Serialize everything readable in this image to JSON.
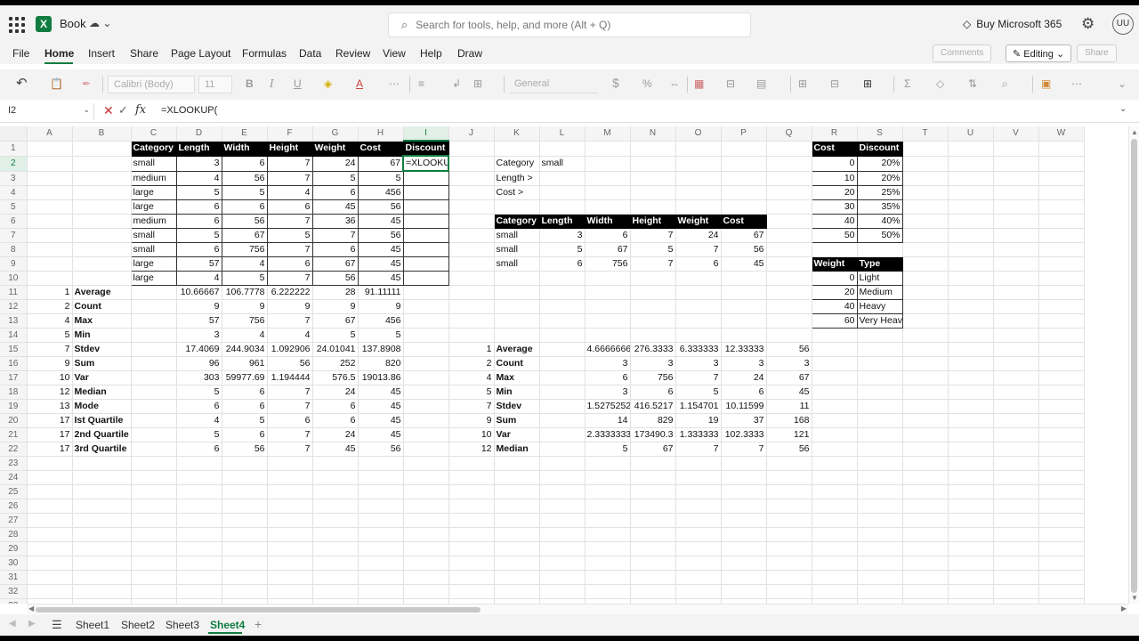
{
  "app": {
    "name": "Book",
    "search_placeholder": "Search for tools, help, and more (Alt + Q)",
    "buy_label": "Buy Microsoft 365",
    "avatar": "UU"
  },
  "menu": {
    "items": [
      "File",
      "Home",
      "Insert",
      "Share",
      "Page Layout",
      "Formulas",
      "Data",
      "Review",
      "View",
      "Help",
      "Draw"
    ],
    "comments": "Comments",
    "editing": "Editing",
    "share": "Share"
  },
  "ribbon": {
    "font": "Calibri (Body)",
    "size": "11",
    "format": "General"
  },
  "formula_bar": {
    "cell": "I2",
    "formula": "=XLOOKUP("
  },
  "columns": [
    "A",
    "B",
    "C",
    "D",
    "E",
    "F",
    "G",
    "H",
    "I",
    "J",
    "K",
    "L",
    "M",
    "N",
    "O",
    "P",
    "Q",
    "R",
    "S",
    "T",
    "U",
    "V",
    "W"
  ],
  "rows": [
    [
      "",
      "",
      "Category",
      "Length",
      "Width",
      "Height",
      "Weight",
      "Cost",
      "Discount",
      "",
      "",
      "",
      "",
      "",
      "",
      "",
      "",
      "Cost",
      "Discount",
      "",
      "",
      "",
      ""
    ],
    [
      "",
      "",
      "small",
      "3",
      "6",
      "7",
      "24",
      "67",
      "=XLOOKUP(",
      "",
      "Category",
      "small",
      "",
      "",
      "",
      "",
      "",
      "0",
      "20%",
      "",
      "",
      "",
      ""
    ],
    [
      "",
      "",
      "medium",
      "4",
      "56",
      "7",
      "5",
      "5",
      "",
      "",
      "Length >",
      "",
      "",
      "",
      "",
      "",
      "",
      "10",
      "20%",
      "",
      "",
      "",
      ""
    ],
    [
      "",
      "",
      "large",
      "5",
      "5",
      "4",
      "6",
      "456",
      "",
      "",
      "Cost >",
      "",
      "",
      "",
      "",
      "",
      "",
      "20",
      "25%",
      "",
      "",
      "",
      ""
    ],
    [
      "",
      "",
      "large",
      "6",
      "6",
      "6",
      "45",
      "56",
      "",
      "",
      "",
      "",
      "",
      "",
      "",
      "",
      "",
      "30",
      "35%",
      "",
      "",
      "",
      ""
    ],
    [
      "",
      "",
      "medium",
      "6",
      "56",
      "7",
      "36",
      "45",
      "",
      "",
      "Category",
      "Length",
      "Width",
      "Height",
      "Weight",
      "Cost",
      "",
      "40",
      "40%",
      "",
      "",
      "",
      ""
    ],
    [
      "",
      "",
      "small",
      "5",
      "67",
      "5",
      "7",
      "56",
      "",
      "",
      "small",
      "3",
      "6",
      "7",
      "24",
      "67",
      "",
      "50",
      "50%",
      "",
      "",
      "",
      ""
    ],
    [
      "",
      "",
      "small",
      "6",
      "756",
      "7",
      "6",
      "45",
      "",
      "",
      "small",
      "5",
      "67",
      "5",
      "7",
      "56",
      "",
      "",
      "",
      "",
      "",
      "",
      ""
    ],
    [
      "",
      "",
      "large",
      "57",
      "4",
      "6",
      "67",
      "45",
      "",
      "",
      "small",
      "6",
      "756",
      "7",
      "6",
      "45",
      "",
      "Weight",
      "Type",
      "",
      "",
      "",
      ""
    ],
    [
      "",
      "",
      "large",
      "4",
      "5",
      "7",
      "56",
      "45",
      "",
      "",
      "",
      "",
      "",
      "",
      "",
      "",
      "",
      "0",
      "Light",
      "",
      "",
      "",
      ""
    ],
    [
      "1",
      "Average",
      "",
      "10.66667",
      "106.7778",
      "6.222222",
      "28",
      "91.11111",
      "",
      "",
      "",
      "",
      "",
      "",
      "",
      "",
      "",
      "20",
      "Medium",
      "",
      "",
      "",
      ""
    ],
    [
      "2",
      "Count",
      "",
      "9",
      "9",
      "9",
      "9",
      "9",
      "",
      "",
      "",
      "",
      "",
      "",
      "",
      "",
      "",
      "40",
      "Heavy",
      "",
      "",
      "",
      ""
    ],
    [
      "4",
      "Max",
      "",
      "57",
      "756",
      "7",
      "67",
      "456",
      "",
      "",
      "",
      "",
      "",
      "",
      "",
      "",
      "",
      "60",
      "Very Heavy",
      "",
      "",
      "",
      ""
    ],
    [
      "5",
      "Min",
      "",
      "3",
      "4",
      "4",
      "5",
      "5",
      "",
      "",
      "",
      "",
      "",
      "",
      "",
      "",
      "",
      "",
      "",
      "",
      "",
      "",
      ""
    ],
    [
      "7",
      "Stdev",
      "",
      "17.4069",
      "244.9034",
      "1.092906",
      "24.01041",
      "137.8908",
      "",
      "1",
      "Average",
      "",
      "4.66666667",
      "276.3333",
      "6.333333",
      "12.33333",
      "56",
      "",
      "",
      "",
      "",
      "",
      ""
    ],
    [
      "9",
      "Sum",
      "",
      "96",
      "961",
      "56",
      "252",
      "820",
      "",
      "2",
      "Count",
      "",
      "3",
      "3",
      "3",
      "3",
      "3",
      "",
      "",
      "",
      "",
      "",
      ""
    ],
    [
      "10",
      "Var",
      "",
      "303",
      "59977.69",
      "1.194444",
      "576.5",
      "19013.86",
      "",
      "4",
      "Max",
      "",
      "6",
      "756",
      "7",
      "24",
      "67",
      "",
      "",
      "",
      "",
      "",
      ""
    ],
    [
      "12",
      "Median",
      "",
      "5",
      "6",
      "7",
      "24",
      "45",
      "",
      "5",
      "Min",
      "",
      "3",
      "6",
      "5",
      "6",
      "45",
      "",
      "",
      "",
      "",
      "",
      ""
    ],
    [
      "13",
      "Mode",
      "",
      "6",
      "6",
      "7",
      "6",
      "45",
      "",
      "7",
      "Stdev",
      "",
      "1.52752523",
      "416.5217",
      "1.154701",
      "10.11599",
      "11",
      "",
      "",
      "",
      "",
      "",
      ""
    ],
    [
      "17",
      "Ist Quartile",
      "",
      "4",
      "5",
      "6",
      "6",
      "45",
      "",
      "9",
      "Sum",
      "",
      "14",
      "829",
      "19",
      "37",
      "168",
      "",
      "",
      "",
      "",
      "",
      ""
    ],
    [
      "17",
      "2nd Quartile",
      "",
      "5",
      "6",
      "7",
      "24",
      "45",
      "",
      "10",
      "Var",
      "",
      "2.33333333",
      "173490.3",
      "1.333333",
      "102.3333",
      "121",
      "",
      "",
      "",
      "",
      "",
      ""
    ],
    [
      "17",
      "3rd Quartile",
      "",
      "6",
      "56",
      "7",
      "45",
      "56",
      "",
      "12",
      "Median",
      "",
      "5",
      "67",
      "7",
      "7",
      "56",
      "",
      "",
      "",
      "",
      "",
      ""
    ]
  ],
  "sheets": [
    "Sheet1",
    "Sheet2",
    "Sheet3",
    "Sheet4"
  ],
  "active_sheet": "Sheet4",
  "colors": {
    "accent": "#107c41",
    "header_fill": "#000000"
  }
}
